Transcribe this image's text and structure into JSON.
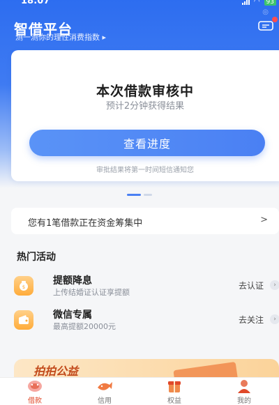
{
  "status_bar": {
    "time": "18:07",
    "battery": "93"
  },
  "header": {
    "title": "智借平台",
    "subtitle": "测一测你的理性消费指数 ▸"
  },
  "review_card": {
    "title": "本次借款审核中",
    "subtitle": "预计2分钟获得结果",
    "button_label": "查看进度",
    "note": "审批结果将第一时间短信通知您"
  },
  "notice": {
    "text": "您有1笔借款正在资金筹集中",
    "arrow": ">"
  },
  "hot_activities": {
    "title": "热门活动",
    "items": [
      {
        "title": "提额降息",
        "desc": "上传结婚证认证享提额",
        "action": "去认证",
        "icon": "money-bag-icon"
      },
      {
        "title": "微信专属",
        "desc": "最高提额20000元",
        "action": "去关注",
        "icon": "wallet-icon"
      }
    ]
  },
  "banner": {
    "text": "拍拍公益"
  },
  "tabs": [
    {
      "label": "借款",
      "icon": "piggy-bank-icon",
      "active": true
    },
    {
      "label": "信用",
      "icon": "fish-icon",
      "active": false
    },
    {
      "label": "权益",
      "icon": "gift-icon",
      "active": false
    },
    {
      "label": "我的",
      "icon": "profile-icon",
      "active": false
    }
  ],
  "colors": {
    "primary": "#4a80f3",
    "accent": "#e0492a",
    "activity_icon": "#ffac3a"
  }
}
